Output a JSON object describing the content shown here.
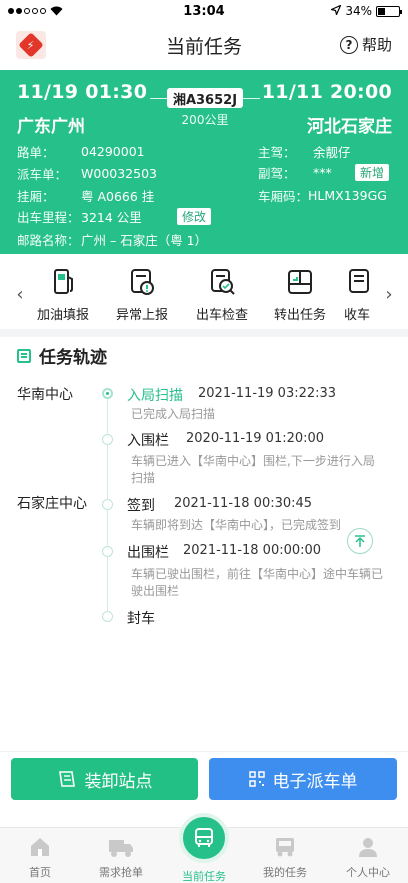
{
  "status_bar": {
    "time": "13:04",
    "battery": "34%",
    "battery_level": 0.34
  },
  "nav": {
    "title": "当前任务",
    "help": "帮助"
  },
  "task": {
    "depart_time": "11/19 01:30",
    "arrive_time": "11/11 20:00",
    "origin": "广东广州",
    "destination": "河北石家庄",
    "plate": "湘A3652J",
    "distance": "200公里",
    "route_no_label": "路单：",
    "route_no": "04290001",
    "dispatch_no_label": "派车单：",
    "dispatch_no": "W00032503",
    "trailer_label": "挂厢：",
    "trailer": "粤 A0666 挂",
    "mileage_label": "出车里程：",
    "mileage": "3214 公里",
    "edit": "修改",
    "route_name_label": "邮路名称：",
    "route_name": "广州 – 石家庄（粤 1）",
    "main_driver_label": "主驾：",
    "main_driver": "余靓仔",
    "co_driver_label": "副驾：",
    "co_driver": "***",
    "add": "新增",
    "box_code_label": "车厢码：",
    "box_code": "HLMX139GG"
  },
  "actions": [
    {
      "label": "加油填报",
      "icon": "fuel-icon"
    },
    {
      "label": "异常上报",
      "icon": "exception-report-icon"
    },
    {
      "label": "出车检查",
      "icon": "vehicle-check-icon"
    },
    {
      "label": "转出任务",
      "icon": "transfer-task-icon"
    },
    {
      "label": "收车",
      "icon": "receive-vehicle-icon"
    }
  ],
  "trajectory": {
    "title": "任务轨迹",
    "stations": [
      "华南中心",
      "石家庄中心"
    ],
    "events": [
      {
        "title": "入局扫描",
        "time": "2021-11-19 03:22:33",
        "desc": "已完成入局扫描"
      },
      {
        "title": "入围栏",
        "time": "2020-11-19 01:20:00",
        "desc": "车辆已进入【华南中心】围栏,下一步进行入局扫描"
      },
      {
        "title": "签到",
        "time": "2021-11-18 00:30:45",
        "desc": "车辆即将到达【华南中心】，已完成签到"
      },
      {
        "title": "出围栏",
        "time": "2021-11-18 00:00:00",
        "desc": "车辆已驶出围栏，前往【华南中心】途中车辆已驶出围栏"
      },
      {
        "title": "封车",
        "time": "",
        "desc": ""
      }
    ]
  },
  "buttons": {
    "load_station": "装卸站点",
    "e_dispatch": "电子派车单"
  },
  "tabs": [
    {
      "label": "首页",
      "icon": "home-icon"
    },
    {
      "label": "需求抢单",
      "icon": "truck-icon"
    },
    {
      "label": "当前任务",
      "icon": "bus-icon"
    },
    {
      "label": "我的任务",
      "icon": "task-truck-icon"
    },
    {
      "label": "个人中心",
      "icon": "user-icon"
    }
  ],
  "colors": {
    "primary": "#26c08a",
    "blue": "#3e8ef0",
    "logo": "#e2362a"
  }
}
